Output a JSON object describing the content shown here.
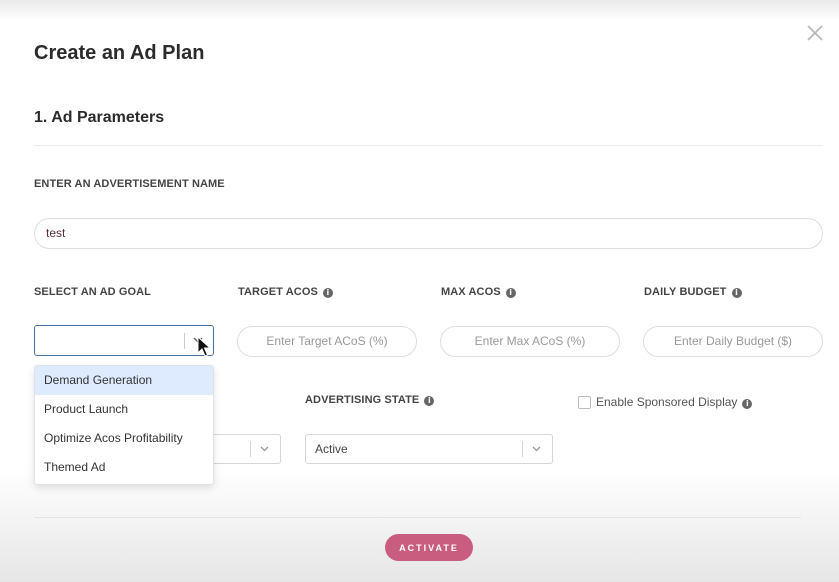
{
  "modal": {
    "title": "Create an Ad Plan",
    "section_title": "1. Ad Parameters"
  },
  "ad_name": {
    "label": "ENTER AN ADVERTISEMENT NAME",
    "value": "test"
  },
  "ad_goal": {
    "label": "SELECT AN AD GOAL",
    "selected": "",
    "options": [
      "Demand Generation",
      "Product Launch",
      "Optimize Acos Profitability",
      "Themed Ad"
    ],
    "highlighted": "Demand Generation"
  },
  "target_acos": {
    "label": "TARGET ACOS",
    "placeholder": "Enter Target ACoS (%)"
  },
  "max_acos": {
    "label": "MAX ACOS",
    "placeholder": "Enter Max ACoS (%)"
  },
  "daily_budget": {
    "label": "DAILY BUDGET",
    "placeholder": "Enter Daily Budget ($)"
  },
  "advertising_state": {
    "label": "ADVERTISING STATE",
    "value": "Active"
  },
  "sponsored_display": {
    "label": "Enable Sponsored Display",
    "checked": false
  },
  "footer": {
    "activate_label": "ACTIVATE"
  },
  "colors": {
    "accent": "#c95d7f",
    "focus": "#4a6fa5",
    "highlight": "#deebff"
  }
}
